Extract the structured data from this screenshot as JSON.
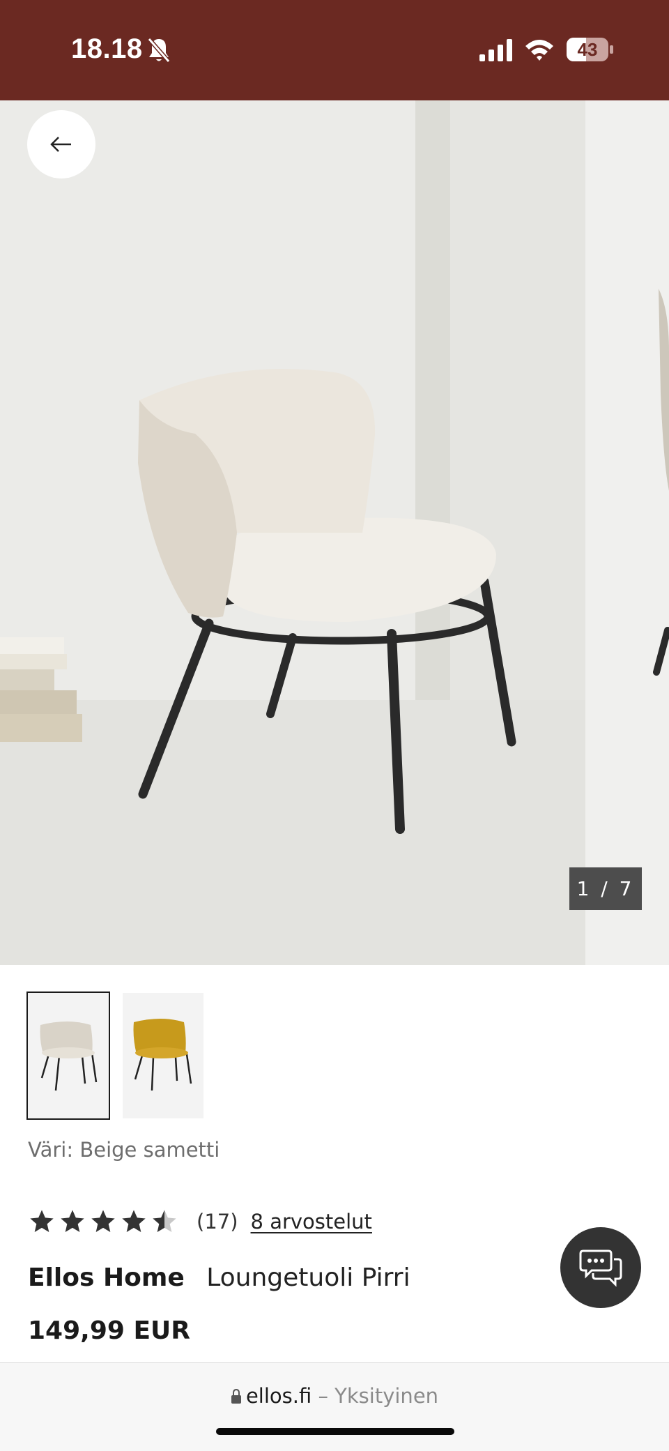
{
  "status_bar": {
    "time": "18.18",
    "battery": "43",
    "icons": [
      "bell-slash-icon",
      "signal-icon",
      "wifi-icon",
      "battery-icon"
    ],
    "background": "#6b2922"
  },
  "gallery": {
    "counter": "1 / 7",
    "back_icon": "arrow-left-icon"
  },
  "thumbnails": [
    {
      "name": "beige-chair",
      "selected": true
    },
    {
      "name": "yellow-chair",
      "selected": false
    }
  ],
  "product": {
    "color_label": "Väri: Beige sametti",
    "rating": 4.5,
    "rating_count": "(17)",
    "reviews_link": "8 arvostelut",
    "brand": "Ellos Home",
    "name": "Loungetuoli Pirri",
    "price": "149,99 EUR"
  },
  "chat_icon": "chat-icon",
  "url_bar": {
    "domain": "ellos.fi",
    "separator": "–",
    "mode": "Yksityinen",
    "lock_icon": "lock-icon"
  },
  "colors": {
    "status_bar": "#6b2922",
    "chat_button": "#333333",
    "counter_bg": "#4d4d4d"
  }
}
